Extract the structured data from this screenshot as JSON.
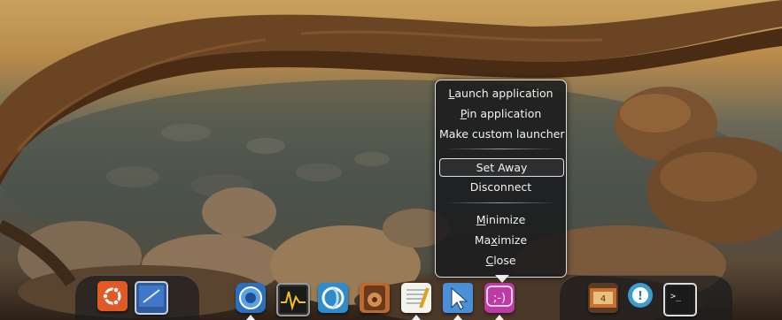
{
  "context_menu": {
    "items": [
      {
        "pre": "",
        "ul": "L",
        "post": "aunch application"
      },
      {
        "pre": "",
        "ul": "P",
        "post": "in application"
      },
      {
        "pre": "Make custom launcher",
        "ul": "",
        "post": ""
      },
      {
        "pre": "Set Away",
        "ul": "",
        "post": ""
      },
      {
        "pre": "Disconnect",
        "ul": "",
        "post": ""
      },
      {
        "pre": "",
        "ul": "M",
        "post": "inimize"
      },
      {
        "pre": "Ma",
        "ul": "x",
        "post": "imize"
      },
      {
        "pre": "",
        "ul": "C",
        "post": "lose"
      }
    ]
  },
  "dock": {
    "left_icons": [
      "ubuntu-icon",
      "desktop-icon"
    ],
    "center_icons": [
      "browser-icon",
      "system-monitor-icon",
      "blender-icon",
      "speaker-icon",
      "text-editor-icon",
      "cursor-icon",
      "chat-icon"
    ],
    "right_icons": [
      "mixer-icon",
      "help-icon",
      "terminal-icon"
    ]
  }
}
